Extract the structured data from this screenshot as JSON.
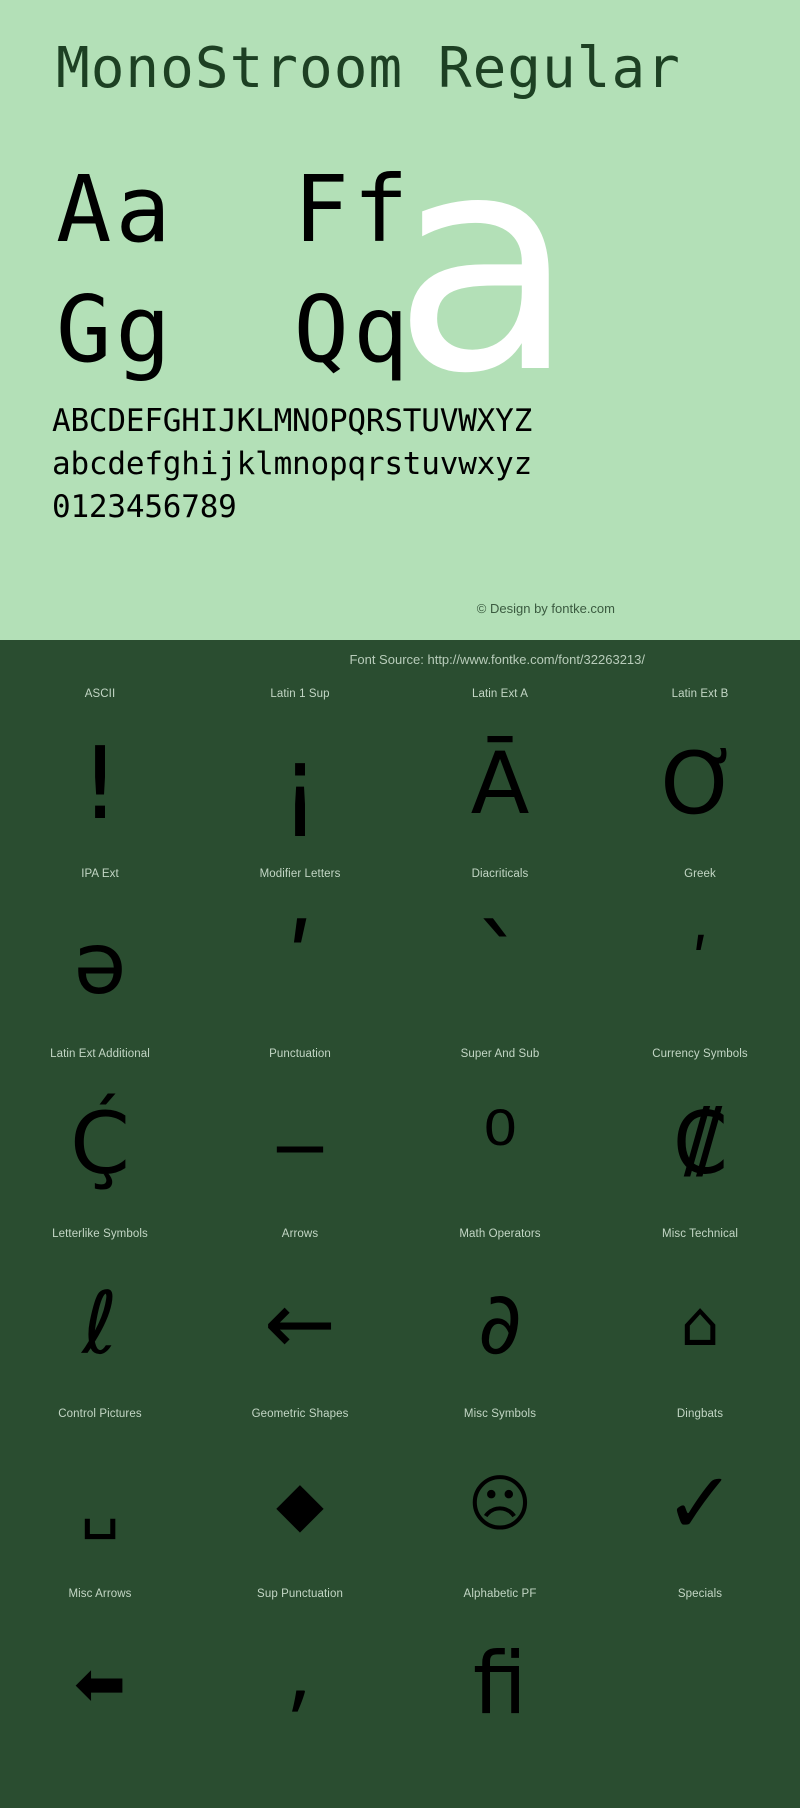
{
  "specimen": {
    "title": "MonoStroom Regular",
    "big_rows": [
      "Aa  Ff",
      "Gg  Qq"
    ],
    "hero_glyph": "a",
    "alphabet_lines": [
      "ABCDEFGHIJKLMNOPQRSTUVWXYZ",
      "abcdefghijklmnopqrstuvwxyz",
      "0123456789"
    ],
    "copyright": "© Design by fontke.com",
    "colors": {
      "panel_background": "#b3e0b7",
      "title_text": "#1d4023",
      "hero_glyph": "#ffffff",
      "sample_text": "#000000"
    }
  },
  "grid_panel": {
    "font_source": "Font Source: http://www.fontke.com/font/32263213/",
    "colors": {
      "background": "#2a4d30",
      "label_text": "#c3d6c5",
      "glyph": "#000000"
    },
    "cells": [
      {
        "label": "ASCII",
        "glyph": "!",
        "size": "tall"
      },
      {
        "label": "Latin 1 Sup",
        "glyph": "¡",
        "size": "tall"
      },
      {
        "label": "Latin Ext A",
        "glyph": "Ā",
        "size": "normal"
      },
      {
        "label": "Latin Ext B",
        "glyph": "Ơ",
        "size": "normal"
      },
      {
        "label": "IPA Ext",
        "glyph": "ə",
        "size": "normal"
      },
      {
        "label": "Modifier Letters",
        "glyph": "ʹ",
        "size": "tall"
      },
      {
        "label": "Diacriticals",
        "glyph": "ˋ",
        "size": "tall"
      },
      {
        "label": "Greek",
        "glyph": "ʹ",
        "size": "small"
      },
      {
        "label": "Latin Ext Additional",
        "glyph": "Ḉ",
        "size": "normal"
      },
      {
        "label": "Punctuation",
        "glyph": "‒",
        "size": "normal"
      },
      {
        "label": "Super And Sub",
        "glyph": "⁰",
        "size": "normal"
      },
      {
        "label": "Currency Symbols",
        "glyph": "₡",
        "size": "normal"
      },
      {
        "label": "Letterlike Symbols",
        "glyph": "ℓ",
        "size": "normal"
      },
      {
        "label": "Arrows",
        "glyph": "←",
        "size": "normal"
      },
      {
        "label": "Math Operators",
        "glyph": "∂",
        "size": "normal"
      },
      {
        "label": "Misc Technical",
        "glyph": "⌂",
        "size": "small"
      },
      {
        "label": "Control Pictures",
        "glyph": "␣",
        "size": "small"
      },
      {
        "label": "Geometric Shapes",
        "glyph": "◆",
        "size": "small"
      },
      {
        "label": "Misc Symbols",
        "glyph": "☹",
        "size": "small"
      },
      {
        "label": "Dingbats",
        "glyph": "✓",
        "size": "normal"
      },
      {
        "label": "Misc Arrows",
        "glyph": "⬅",
        "size": "small"
      },
      {
        "label": "Sup Punctuation",
        "glyph": "⸴",
        "size": "normal"
      },
      {
        "label": "Alphabetic PF",
        "glyph": "ﬁ",
        "size": "normal"
      },
      {
        "label": "Specials",
        "glyph": "￰",
        "size": "small"
      }
    ]
  }
}
